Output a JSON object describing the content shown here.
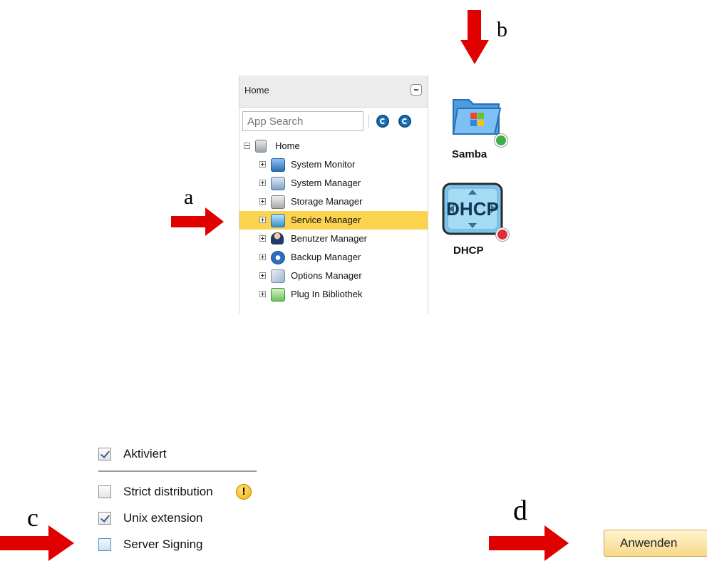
{
  "annotations": {
    "a": "a",
    "b": "b",
    "c": "c",
    "d": "d"
  },
  "panel": {
    "title": "Home",
    "search_placeholder": "App Search",
    "tree": [
      {
        "label": "Home",
        "icon": "computer-icon",
        "expanded": true
      },
      {
        "label": "System Monitor",
        "icon": "monitor-icon"
      },
      {
        "label": "System Manager",
        "icon": "system-manager-icon"
      },
      {
        "label": "Storage Manager",
        "icon": "storage-icon"
      },
      {
        "label": "Service Manager",
        "icon": "service-icon",
        "selected": true
      },
      {
        "label": "Benutzer Manager",
        "icon": "user-icon"
      },
      {
        "label": "Backup Manager",
        "icon": "backup-icon"
      },
      {
        "label": "Options Manager",
        "icon": "options-icon"
      },
      {
        "label": "Plug In Bibliothek",
        "icon": "plugin-icon"
      }
    ]
  },
  "services": [
    {
      "label": "Samba",
      "status": "enabled",
      "icon": "samba-folder-icon"
    },
    {
      "label": "DHCP",
      "status": "disabled",
      "icon": "dhcp-icon"
    }
  ],
  "settings": {
    "enabled": {
      "label": "Aktiviert",
      "checked": true
    },
    "strict_distribution": {
      "label": "Strict distribution",
      "checked": false,
      "warning_glyph": "!"
    },
    "unix_extension": {
      "label": "Unix extension",
      "checked": true
    },
    "server_signing": {
      "label": "Server Signing",
      "checked": false
    },
    "apply_label": "Anwenden"
  },
  "colors": {
    "arrow": "#e10000",
    "selected_row": "#fbd34f",
    "status_ok": "#3fae49",
    "status_error": "#d9303a"
  }
}
